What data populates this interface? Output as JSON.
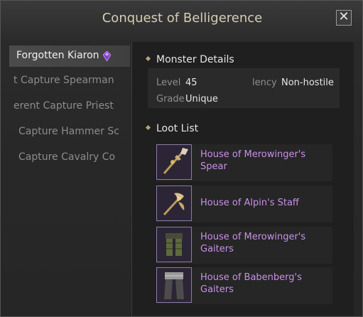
{
  "window": {
    "title": "Conquest of Belligerence",
    "close_label": "✕"
  },
  "sidebar": {
    "items": [
      {
        "label": "Forgotten Kiaron",
        "selected": true
      },
      {
        "label": "t Capture Spearman"
      },
      {
        "label": "erent Capture Priest"
      },
      {
        "label": "Capture Hammer Sc"
      },
      {
        "label": "Capture Cavalry Co"
      }
    ]
  },
  "details": {
    "heading": "Monster Details",
    "level_label": "Level",
    "level_value": "45",
    "tendency_label": "lency",
    "tendency_value": "Non-hostile",
    "grade_label": "Grade",
    "grade_value": "Unique"
  },
  "loot": {
    "heading": "Loot List",
    "items": [
      {
        "name": "House of Merowinger's Spear",
        "icon": "spear-icon"
      },
      {
        "name": "House of Alpin's Staff",
        "icon": "staff-icon"
      },
      {
        "name": "House of Merowinger's Gaiters",
        "icon": "gaiters-icon"
      },
      {
        "name": "House of Babenberg's Gaiters",
        "icon": "gaiters-icon"
      }
    ]
  },
  "colors": {
    "loot_name": "#c890e8",
    "accent_gem": "#8a3fd0",
    "icon_border": "#8d7aa8"
  }
}
